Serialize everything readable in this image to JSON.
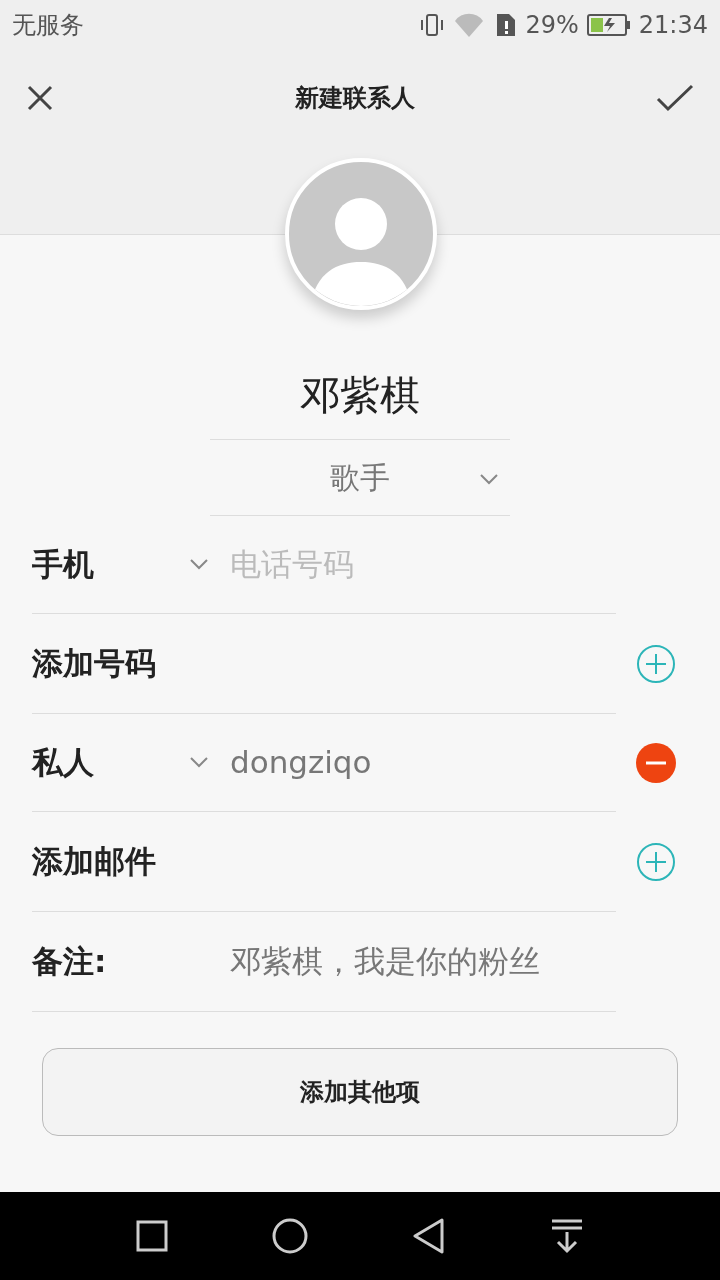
{
  "status_bar": {
    "carrier": "无服务",
    "battery_text": "29%",
    "time": "21:34"
  },
  "header": {
    "title": "新建联系人"
  },
  "contact": {
    "name": "邓紫棋",
    "title_value": "歌手"
  },
  "rows": [
    {
      "kind": "field",
      "label": "手机",
      "placeholder": "电话号码"
    },
    {
      "kind": "add",
      "label": "添加号码"
    },
    {
      "kind": "removable",
      "label": "私人",
      "value": "dongziqo"
    },
    {
      "kind": "add",
      "label": "添加邮件"
    },
    {
      "kind": "note",
      "label": "备注:",
      "value": "邓紫棋，我是你的粉丝"
    }
  ],
  "more_button": "添加其他项"
}
